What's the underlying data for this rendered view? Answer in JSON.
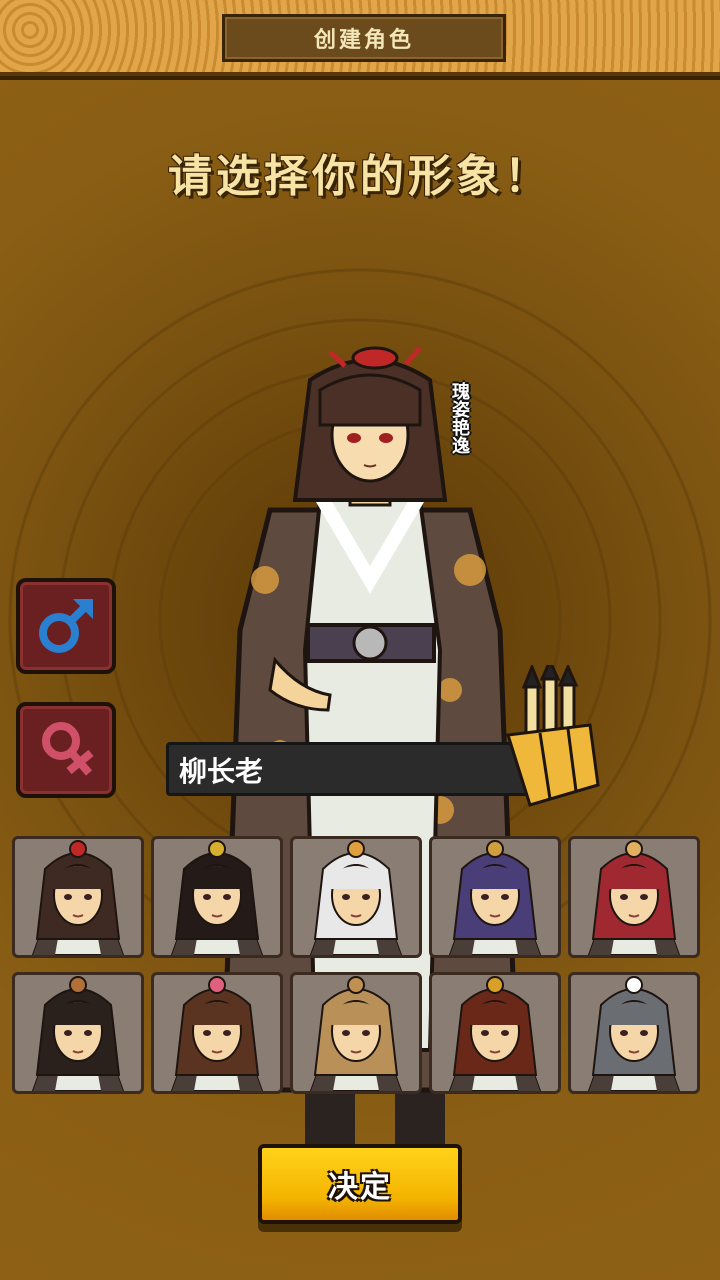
{
  "header": {
    "title": "创建角色"
  },
  "heading": "请选择你的形象！",
  "character": {
    "name": "柳长老",
    "epithet": "瑰姿艳逸"
  },
  "gender": {
    "male_icon": "male-symbol-icon",
    "female_icon": "female-symbol-icon",
    "male_color": "#2a7fd0",
    "female_color": "#d0506a"
  },
  "avatars": [
    {
      "id": "avatar-1",
      "hair": "#3e2a22",
      "accent": "#c02828"
    },
    {
      "id": "avatar-2",
      "hair": "#241a18",
      "accent": "#d8b030"
    },
    {
      "id": "avatar-3",
      "hair": "#e8e8e8",
      "accent": "#e0a040"
    },
    {
      "id": "avatar-4",
      "hair": "#4a3e78",
      "accent": "#d0a040"
    },
    {
      "id": "avatar-5",
      "hair": "#a02830",
      "accent": "#e0b060"
    },
    {
      "id": "avatar-6",
      "hair": "#2a201c",
      "accent": "#b07038"
    },
    {
      "id": "avatar-7",
      "hair": "#5a3420",
      "accent": "#e06080"
    },
    {
      "id": "avatar-8",
      "hair": "#b89058",
      "accent": "#c09050"
    },
    {
      "id": "avatar-9",
      "hair": "#6a2818",
      "accent": "#d8a028"
    },
    {
      "id": "avatar-10",
      "hair": "#6a6e72",
      "accent": "#ffffff"
    }
  ],
  "confirm_label": "决定",
  "colors": {
    "accent_yellow": "#f4b400",
    "bg_brown": "#7a5210"
  }
}
